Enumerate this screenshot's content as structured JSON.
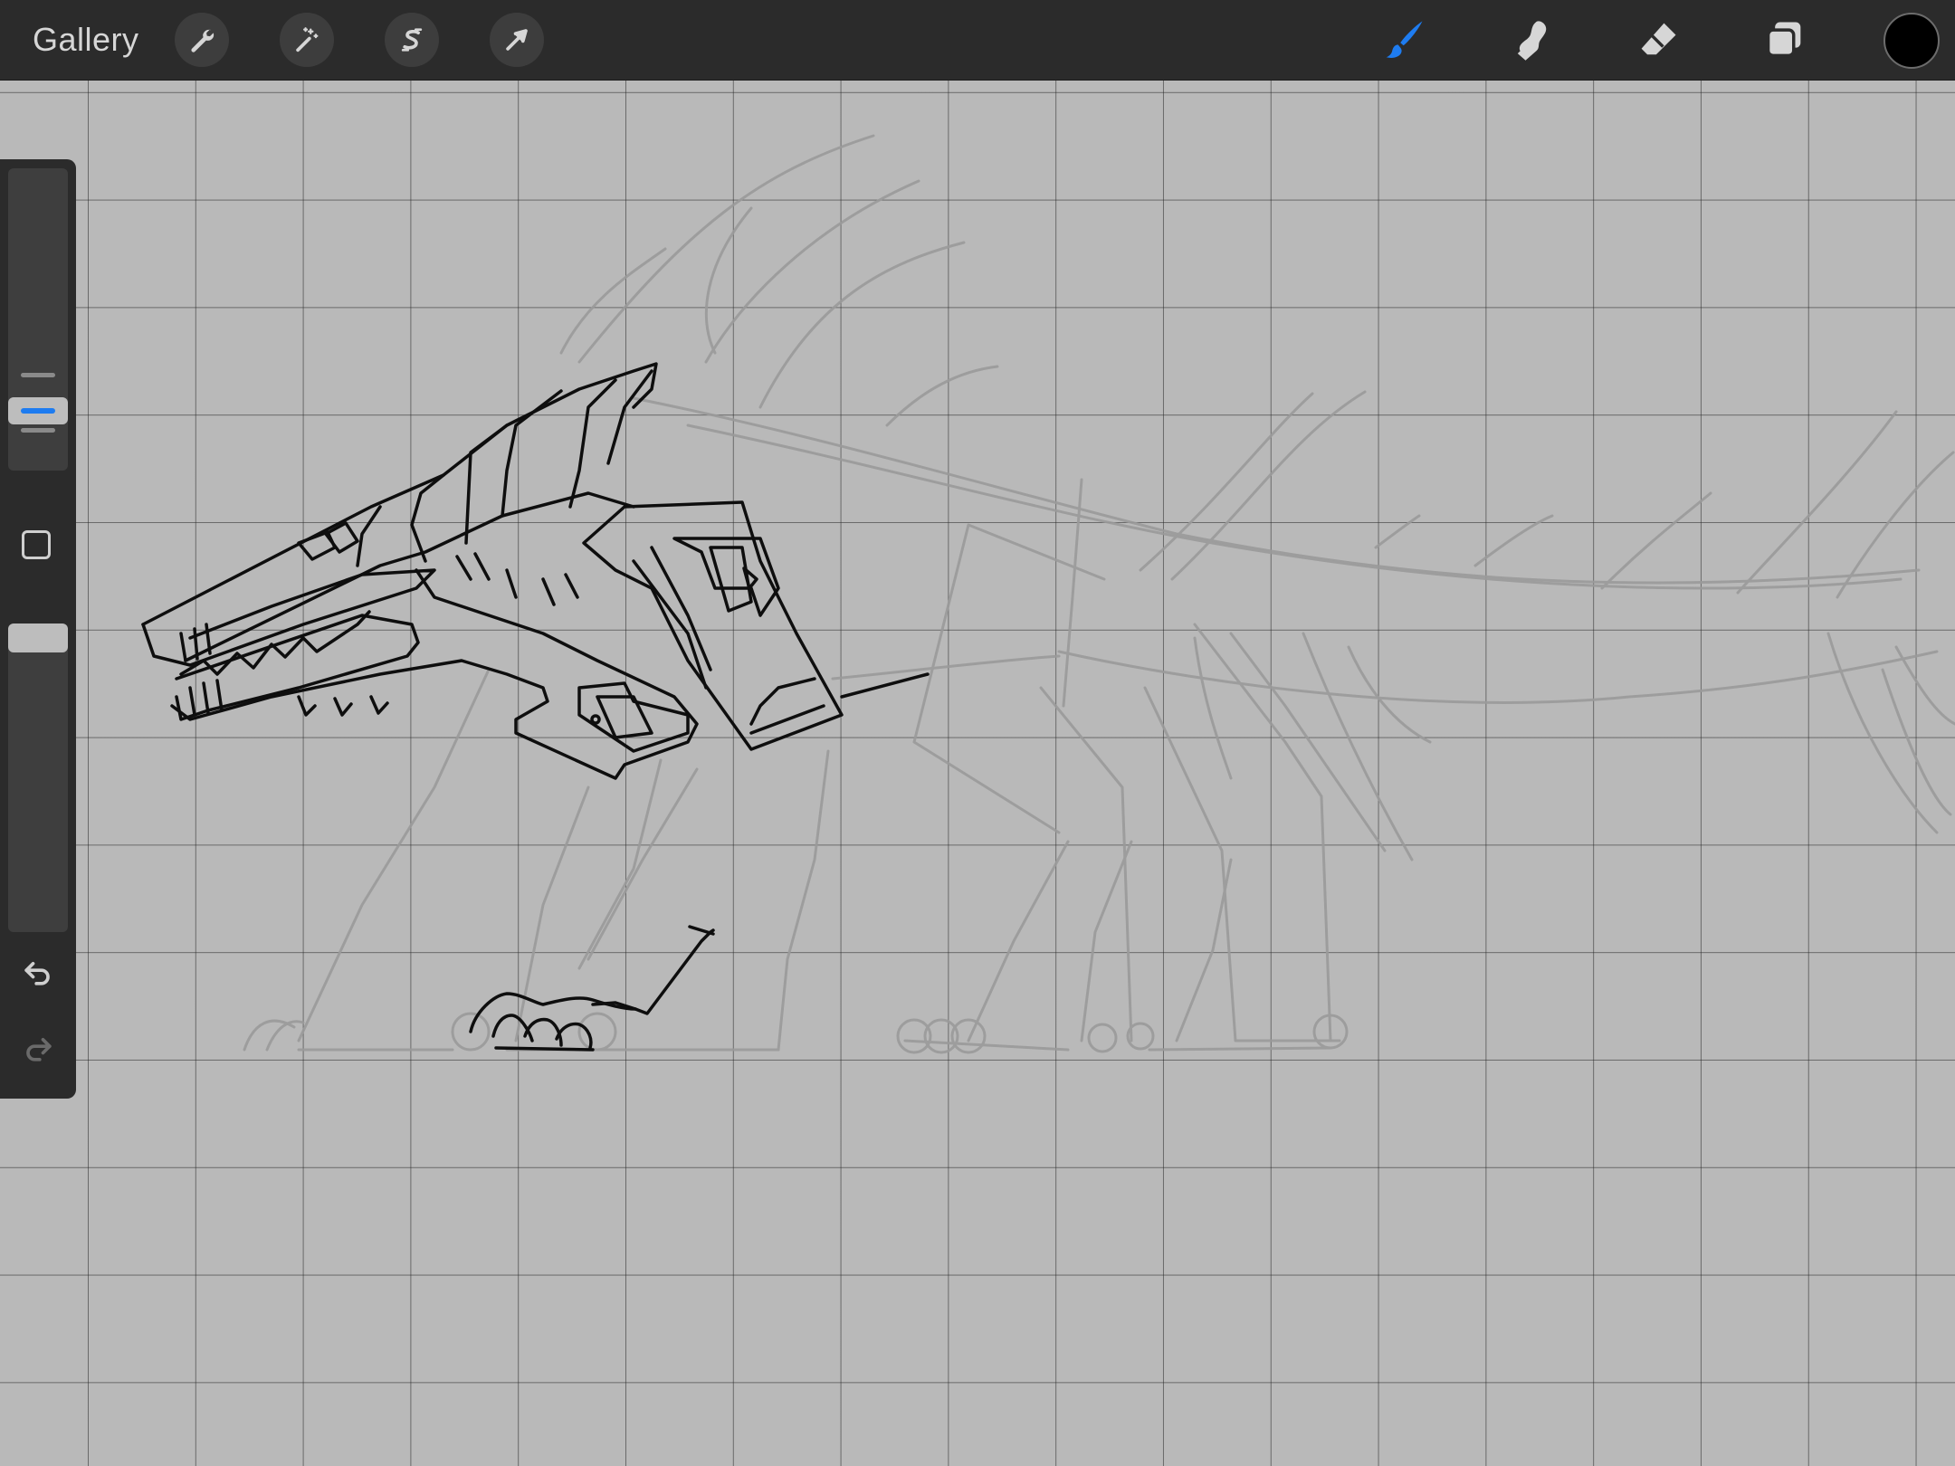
{
  "app": {
    "gallery_label": "Gallery"
  },
  "toolbar_left": [
    {
      "name": "actions",
      "icon": "wrench-icon"
    },
    {
      "name": "adjustments",
      "icon": "magic-wand-icon"
    },
    {
      "name": "selection",
      "icon": "selection-s-icon"
    },
    {
      "name": "transform",
      "icon": "arrow-cursor-icon"
    }
  ],
  "toolbar_right": [
    {
      "name": "brush",
      "icon": "brush-icon",
      "active": true
    },
    {
      "name": "smudge",
      "icon": "smudge-finger-icon",
      "active": false
    },
    {
      "name": "eraser",
      "icon": "eraser-icon",
      "active": false
    },
    {
      "name": "layers",
      "icon": "layers-icon",
      "active": false
    }
  ],
  "current_color": "#000000",
  "accent_color": "#1e7cf0",
  "sidebar": {
    "brush_size_level": 0.12,
    "opacity_level": 1.0,
    "undo_icon": "undo-icon",
    "redo_icon": "redo-icon",
    "modify_icon": "square-modify-icon"
  }
}
